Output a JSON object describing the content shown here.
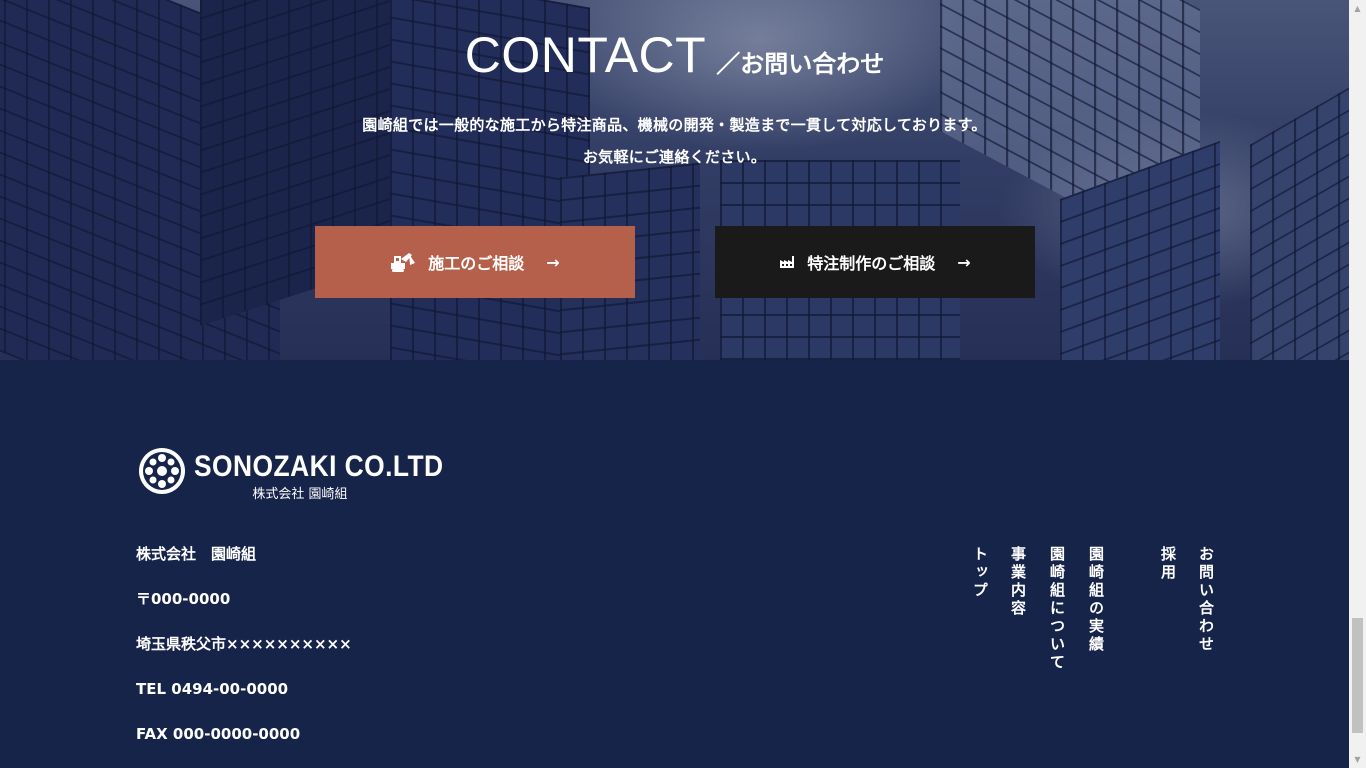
{
  "contact": {
    "title_en": "CONTACT",
    "title_jp": "／お問い合わせ",
    "line1": "園崎組では一般的な施工から特注商品、機械の開発・製造まで一貫して対応しております。",
    "line2": "お気軽にご連絡ください。",
    "buttons": [
      {
        "label": "施工のご相談",
        "icon": "excavator-icon",
        "arrow": "→",
        "color": "#b4604a"
      },
      {
        "label": "特注制作のご相談",
        "icon": "factory-icon",
        "arrow": "→",
        "color": "#1a1a1a"
      }
    ]
  },
  "footer": {
    "logo_en": "SONOZAKI CO.LTD",
    "logo_jp": "株式会社 園崎組",
    "info": [
      "株式会社　園崎組",
      "〒000-0000",
      "埼玉県秩父市××××××××××",
      "TEL 0494-00-0000",
      "FAX 000-0000-0000"
    ],
    "nav": [
      "トップ",
      "事業内容",
      "園崎組について",
      "園崎組の実績",
      "採用",
      "お問い合わせ"
    ],
    "background": "#17244a"
  },
  "scrollbar": {
    "up": "▲",
    "down": "▼"
  }
}
